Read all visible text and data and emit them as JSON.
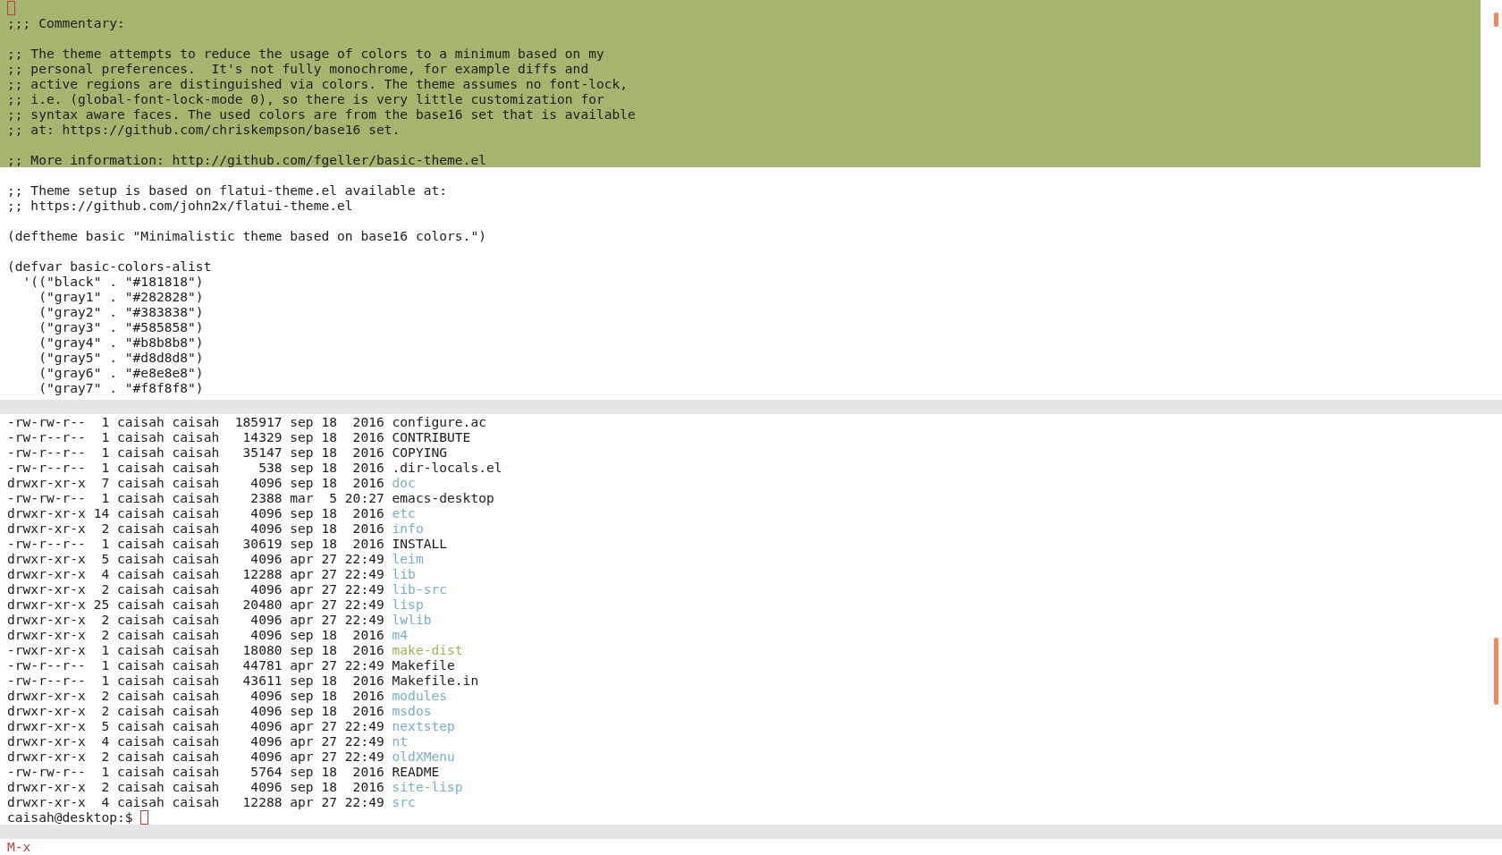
{
  "top_window": {
    "cursor": true,
    "region": {
      "lines": [
        {
          "kind": "code",
          "text": ";;; Commentary:"
        },
        {
          "kind": "blank"
        },
        {
          "kind": "code",
          "text": ";; The theme attempts to reduce the usage of colors to a minimum based on my"
        },
        {
          "kind": "code",
          "text": ";; personal preferences.  It's not fully monochrome, for example diffs and"
        },
        {
          "kind": "code",
          "text": ";; active regions are distinguished via colors. The theme assumes no font-lock,"
        },
        {
          "kind": "code",
          "text": ";; i.e. (global-font-lock-mode 0), so there is very little customization for"
        },
        {
          "kind": "code",
          "text": ";; syntax aware faces. The used colors are from the base16 set that is available"
        },
        {
          "kind": "code",
          "text": ";; at: https://github.com/chriskempson/base16 set."
        },
        {
          "kind": "blank"
        },
        {
          "kind": "code",
          "text": ";; More information: http://github.com/fgeller/basic-theme.el"
        }
      ]
    },
    "lines": [
      {
        "kind": "blank"
      },
      {
        "kind": "code",
        "text": ";; Theme setup is based on flatui-theme.el available at:"
      },
      {
        "kind": "code",
        "text": ";; https://github.com/john2x/flatui-theme.el"
      },
      {
        "kind": "blank"
      },
      {
        "kind": "code",
        "text": "(deftheme basic \"Minimalistic theme based on base16 colors.\")"
      },
      {
        "kind": "blank"
      },
      {
        "kind": "code",
        "text": "(defvar basic-colors-alist"
      },
      {
        "kind": "code",
        "text": "  '((\"black\" . \"#181818\")"
      },
      {
        "kind": "code",
        "text": "    (\"gray1\" . \"#282828\")"
      },
      {
        "kind": "code",
        "text": "    (\"gray2\" . \"#383838\")"
      },
      {
        "kind": "code",
        "text": "    (\"gray3\" . \"#585858\")"
      },
      {
        "kind": "code",
        "text": "    (\"gray4\" . \"#b8b8b8\")"
      },
      {
        "kind": "code",
        "text": "    (\"gray5\" . \"#d8d8d8\")"
      },
      {
        "kind": "code",
        "text": "    (\"gray6\" . \"#e8e8e8\")"
      },
      {
        "kind": "code",
        "text": "    (\"gray7\" . \"#f8f8f8\")"
      }
    ]
  },
  "bottom_window": {
    "rows": [
      {
        "info": "-rw-rw-r--  1 caisah caisah  185917 sep 18  2016",
        "name": "configure.ac",
        "kind": "file"
      },
      {
        "info": "-rw-r--r--  1 caisah caisah   14329 sep 18  2016",
        "name": "CONTRIBUTE",
        "kind": "file"
      },
      {
        "info": "-rw-r--r--  1 caisah caisah   35147 sep 18  2016",
        "name": "COPYING",
        "kind": "file"
      },
      {
        "info": "-rw-r--r--  1 caisah caisah     538 sep 18  2016",
        "name": ".dir-locals.el",
        "kind": "file"
      },
      {
        "info": "drwxr-xr-x  7 caisah caisah    4096 sep 18  2016",
        "name": "doc",
        "kind": "dir"
      },
      {
        "info": "-rw-rw-r--  1 caisah caisah    2388 mar  5 20:27",
        "name": "emacs-desktop",
        "kind": "file"
      },
      {
        "info": "drwxr-xr-x 14 caisah caisah    4096 sep 18  2016",
        "name": "etc",
        "kind": "dir"
      },
      {
        "info": "drwxr-xr-x  2 caisah caisah    4096 sep 18  2016",
        "name": "info",
        "kind": "dir"
      },
      {
        "info": "-rw-r--r--  1 caisah caisah   30619 sep 18  2016",
        "name": "INSTALL",
        "kind": "file"
      },
      {
        "info": "drwxr-xr-x  5 caisah caisah    4096 apr 27 22:49",
        "name": "leim",
        "kind": "dir"
      },
      {
        "info": "drwxr-xr-x  4 caisah caisah   12288 apr 27 22:49",
        "name": "lib",
        "kind": "dir"
      },
      {
        "info": "drwxr-xr-x  2 caisah caisah    4096 apr 27 22:49",
        "name": "lib-src",
        "kind": "dir"
      },
      {
        "info": "drwxr-xr-x 25 caisah caisah   20480 apr 27 22:49",
        "name": "lisp",
        "kind": "dir"
      },
      {
        "info": "drwxr-xr-x  2 caisah caisah    4096 apr 27 22:49",
        "name": "lwlib",
        "kind": "dir"
      },
      {
        "info": "drwxr-xr-x  2 caisah caisah    4096 sep 18  2016",
        "name": "m4",
        "kind": "dir"
      },
      {
        "info": "-rwxr-xr-x  1 caisah caisah   18080 sep 18  2016",
        "name": "make-dist",
        "kind": "exec"
      },
      {
        "info": "-rw-r--r--  1 caisah caisah   44781 apr 27 22:49",
        "name": "Makefile",
        "kind": "file"
      },
      {
        "info": "-rw-r--r--  1 caisah caisah   43611 sep 18  2016",
        "name": "Makefile.in",
        "kind": "file"
      },
      {
        "info": "drwxr-xr-x  2 caisah caisah    4096 sep 18  2016",
        "name": "modules",
        "kind": "dir"
      },
      {
        "info": "drwxr-xr-x  2 caisah caisah    4096 sep 18  2016",
        "name": "msdos",
        "kind": "dir"
      },
      {
        "info": "drwxr-xr-x  5 caisah caisah    4096 apr 27 22:49",
        "name": "nextstep",
        "kind": "dir"
      },
      {
        "info": "drwxr-xr-x  4 caisah caisah    4096 apr 27 22:49",
        "name": "nt",
        "kind": "dir"
      },
      {
        "info": "drwxr-xr-x  2 caisah caisah    4096 apr 27 22:49",
        "name": "oldXMenu",
        "kind": "dir"
      },
      {
        "info": "-rw-rw-r--  1 caisah caisah    5764 sep 18  2016",
        "name": "README",
        "kind": "file"
      },
      {
        "info": "drwxr-xr-x  2 caisah caisah    4096 sep 18  2016",
        "name": "site-lisp",
        "kind": "dir"
      },
      {
        "info": "drwxr-xr-x  4 caisah caisah   12288 apr 27 22:49",
        "name": "src",
        "kind": "dir"
      }
    ],
    "prompt": "caisah@desktop:$",
    "cursor": true
  },
  "minibuffer": {
    "text": "M-x"
  }
}
